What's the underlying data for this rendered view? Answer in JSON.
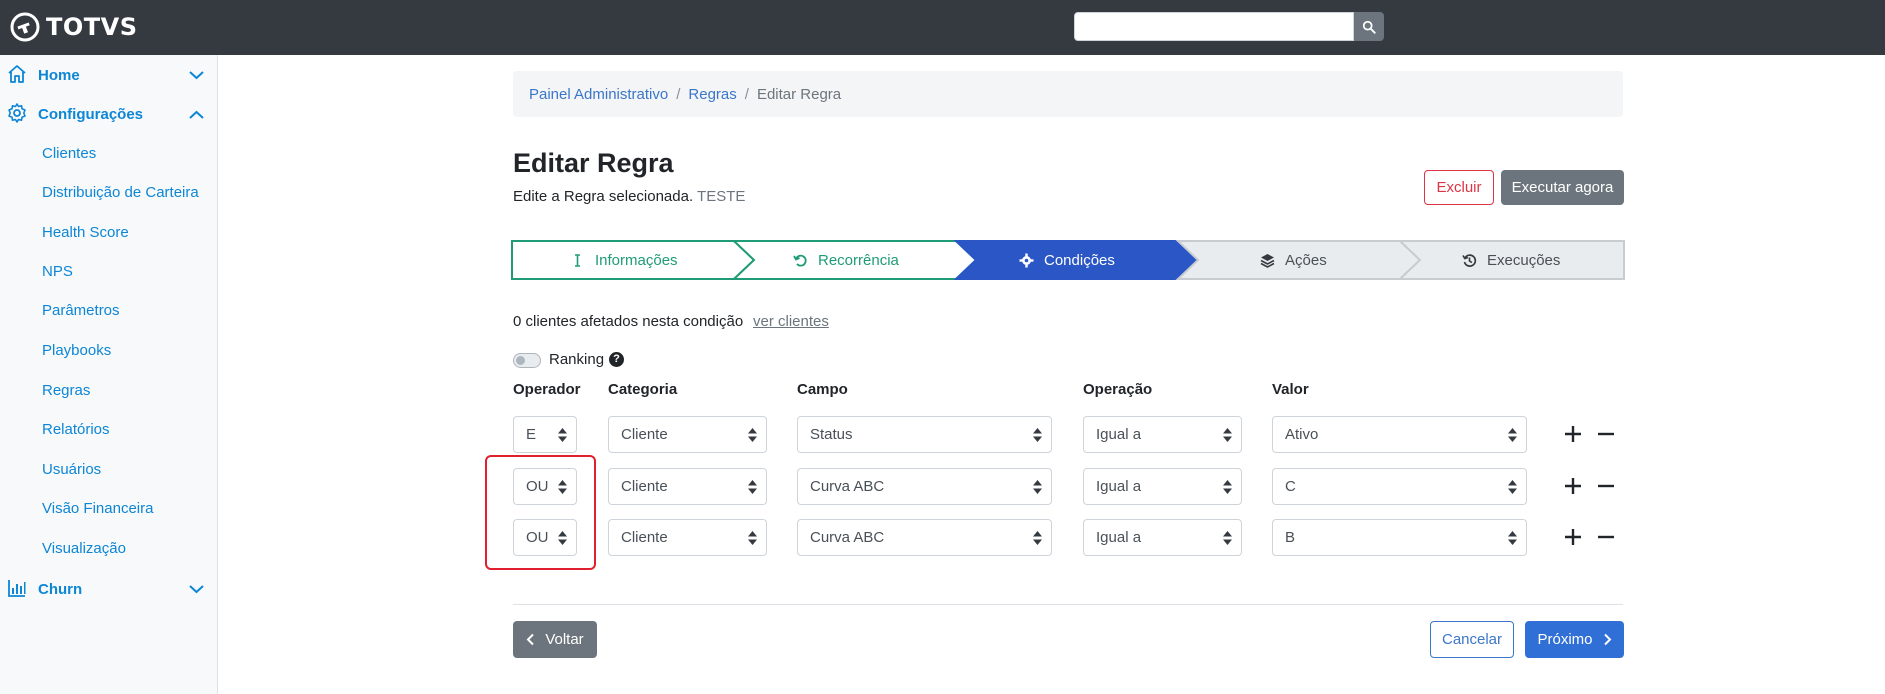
{
  "app": {
    "brand": "TOTVS"
  },
  "search": {
    "placeholder": "",
    "value": "",
    "icon": "search-icon"
  },
  "sidebar": {
    "home": {
      "label": "Home",
      "icon": "home-icon"
    },
    "config": {
      "label": "Configurações",
      "icon": "gear-icon"
    },
    "items": [
      {
        "label": "Clientes"
      },
      {
        "label": "Distribuição de Carteira"
      },
      {
        "label": "Health Score"
      },
      {
        "label": "NPS"
      },
      {
        "label": "Parâmetros"
      },
      {
        "label": "Playbooks"
      },
      {
        "label": "Regras"
      },
      {
        "label": "Relatórios"
      },
      {
        "label": "Usuários"
      },
      {
        "label": "Visão Financeira"
      },
      {
        "label": "Visualização"
      }
    ],
    "churn": {
      "label": "Churn",
      "icon": "bar-chart-icon"
    }
  },
  "breadcrumb": {
    "item1": "Painel Administrativo",
    "item2": "Regras",
    "current": "Editar Regra",
    "separator": "/"
  },
  "page": {
    "title": "Editar Regra",
    "subtitle": "Edite a Regra selecionada.",
    "rule_name": "TESTE"
  },
  "actions": {
    "delete": "Excluir",
    "run_now": "Executar agora"
  },
  "steps": [
    {
      "label": "Informações",
      "state": "done",
      "icon": "cursor-icon"
    },
    {
      "label": "Recorrência",
      "state": "done",
      "icon": "undo-icon"
    },
    {
      "label": "Condições",
      "state": "active",
      "icon": "gear-icon"
    },
    {
      "label": "Ações",
      "state": "pending",
      "icon": "layers-icon"
    },
    {
      "label": "Execuções",
      "state": "pending",
      "icon": "history-icon"
    }
  ],
  "conditions": {
    "affected_text": "0 clientes afetados nesta condição",
    "see_clients": "ver clientes",
    "ranking_label": "Ranking",
    "ranking_enabled": false,
    "help": "?",
    "columns": {
      "operator": "Operador",
      "category": "Categoria",
      "field": "Campo",
      "operation": "Operação",
      "value": "Valor"
    },
    "rows": [
      {
        "operator": "E",
        "category": "Cliente",
        "field": "Status",
        "operation": "Igual a",
        "value": "Ativo"
      },
      {
        "operator": "OU",
        "category": "Cliente",
        "field": "Curva ABC",
        "operation": "Igual a",
        "value": "C"
      },
      {
        "operator": "OU",
        "category": "Cliente",
        "field": "Curva ABC",
        "operation": "Igual a",
        "value": "B"
      }
    ]
  },
  "footer": {
    "back": "Voltar",
    "cancel": "Cancelar",
    "next": "Próximo"
  },
  "colors": {
    "topbar": "#353a40",
    "link": "#0d86d6",
    "step_done": "#1f9c77",
    "step_active": "#2a56c6",
    "step_pending": "#e9ecef",
    "danger": "#dc3545",
    "highlight": "#e0202e",
    "primary": "#2f6fd6"
  }
}
